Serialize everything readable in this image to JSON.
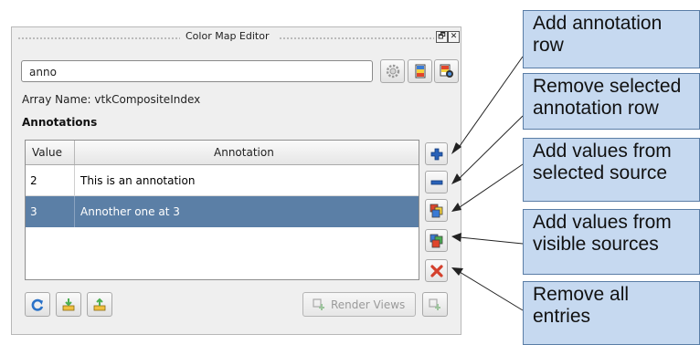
{
  "window": {
    "title": "Color Map Editor",
    "restore_glyph": "🗗",
    "close_glyph": "✕"
  },
  "search": {
    "value": "anno"
  },
  "array_name_label": "Array Name: vtkCompositeIndex",
  "annotations_heading": "Annotations",
  "table": {
    "headers": [
      "Value",
      "Annotation"
    ],
    "rows": [
      {
        "value": "2",
        "annotation": "This is an annotation",
        "selected": false
      },
      {
        "value": "3",
        "annotation": "Annother one at 3",
        "selected": true
      }
    ]
  },
  "buttons": {
    "render_views_label": "Render Views"
  },
  "callouts": [
    "Add annotation row",
    "Remove selected annotation row",
    "Add values from selected source",
    "Add values from visible sources",
    "Remove all entries"
  ],
  "colors": {
    "selection": "#5b7fa6",
    "callout_fill": "#c6d9f0",
    "callout_border": "#5a7da6",
    "add_icon": "#2a62b8",
    "remove_icon": "#d4402c"
  },
  "icons": [
    "gear-icon",
    "color-presets-icon",
    "choose-preset-icon",
    "add-row-icon",
    "remove-row-icon",
    "from-selected-source-icon",
    "from-visible-sources-icon",
    "remove-all-icon",
    "reset-icon",
    "save-icon",
    "import-icon",
    "render-views-icon"
  ]
}
